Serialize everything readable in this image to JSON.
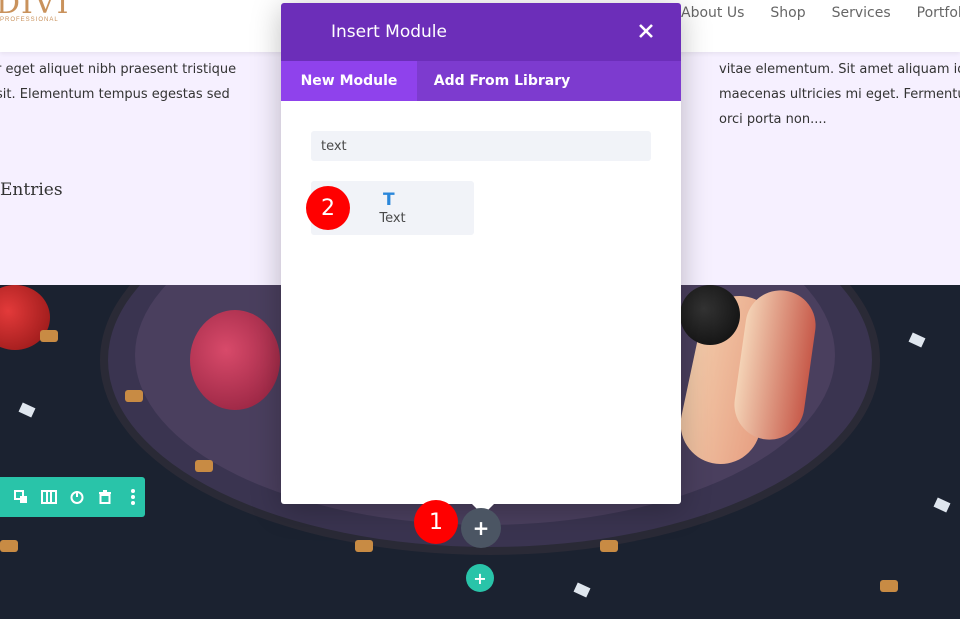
{
  "header": {
    "logo_text": "DIVI",
    "logo_sub": "PROFESSIONAL",
    "nav": [
      "About Us",
      "Shop",
      "Services",
      "Portfolio"
    ]
  },
  "content": {
    "left_lines": [
      "r eget aliquet nibh praesent tristique",
      "sit. Elementum tempus egestas sed"
    ],
    "right_lines": [
      "vitae elementum. Sit amet aliquam id dia",
      "maecenas ultricies mi eget. Fermentum le",
      "orci porta non...."
    ],
    "entries_heading": "Entries"
  },
  "modal": {
    "title": "Insert Module",
    "tabs": {
      "new": "New Module",
      "library": "Add From Library"
    },
    "search_value": "text",
    "module": {
      "icon": "T",
      "label": "Text"
    }
  },
  "badges": {
    "one": "1",
    "two": "2"
  },
  "buttons": {
    "add_module": "+",
    "add_row": "+"
  },
  "colors": {
    "modal_header": "#6c2eb9",
    "tab_active": "#8f42ec",
    "toolbar": "#29c4a9",
    "badge": "#ff0000"
  },
  "icons": [
    "move-icon",
    "columns-icon",
    "power-icon",
    "trash-icon",
    "more-icon",
    "close-icon",
    "text-module-icon",
    "plus-icon"
  ]
}
